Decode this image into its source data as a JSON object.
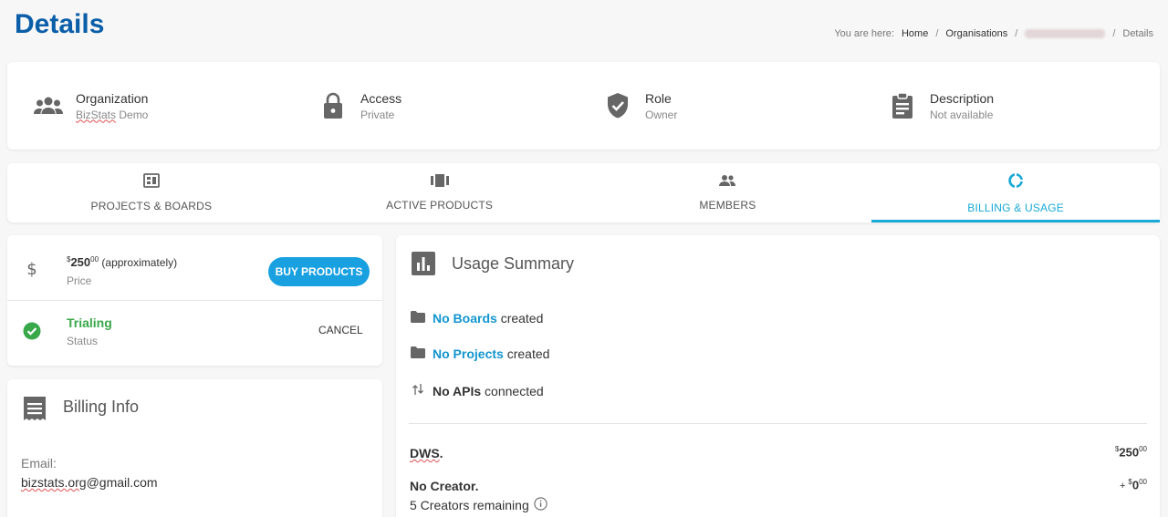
{
  "header": {
    "title": "Details",
    "breadcrumb": {
      "prefix": "You are here:",
      "home": "Home",
      "organisations": "Organisations",
      "current": "Details"
    }
  },
  "info": {
    "organization": {
      "label": "Organization",
      "value": "BizStats Demo",
      "icon": "people-icon"
    },
    "access": {
      "label": "Access",
      "value": "Private",
      "icon": "lock-icon"
    },
    "role": {
      "label": "Role",
      "value": "Owner",
      "icon": "shield-check-icon"
    },
    "description": {
      "label": "Description",
      "value": "Not available",
      "icon": "clipboard-icon"
    }
  },
  "tabs": [
    {
      "label": "PROJECTS & BOARDS",
      "icon": "dashboard-icon",
      "active": false
    },
    {
      "label": "ACTIVE PRODUCTS",
      "icon": "carousel-icon",
      "active": false
    },
    {
      "label": "MEMBERS",
      "icon": "group-icon",
      "active": false
    },
    {
      "label": "BILLING & USAGE",
      "icon": "donut-icon",
      "active": true
    }
  ],
  "pricing": {
    "currency": "$",
    "amount": "250",
    "cents": "00",
    "note": "(approximately)",
    "label": "Price",
    "buy_label": "BUY PRODUCTS",
    "status_value": "Trialing",
    "status_label": "Status",
    "cancel_label": "CANCEL"
  },
  "billing": {
    "title": "Billing Info",
    "email_label": "Email:",
    "email": "bizstats.org@gmail.com"
  },
  "usage": {
    "title": "Usage Summary",
    "boards_link": "No Boards",
    "boards_text": "created",
    "projects_link": "No Projects",
    "projects_text": "created",
    "apis_bold": "No APIs",
    "apis_text": "connected",
    "plan_dws": "DWS",
    "plan_dws_currency": "$",
    "plan_dws_amount": "250",
    "plan_dws_cents": "00",
    "plan_creator": "No Creator",
    "plan_creator_prefix": "+",
    "plan_creator_currency": "$",
    "plan_creator_amount": "0",
    "plan_creator_cents": "00",
    "creators_remaining": "5 Creators remaining"
  },
  "colors": {
    "title": "#0b5ea8",
    "accent": "#18a9d6",
    "button": "#18a0e0",
    "success": "#38a84a",
    "link": "#1295cf"
  }
}
